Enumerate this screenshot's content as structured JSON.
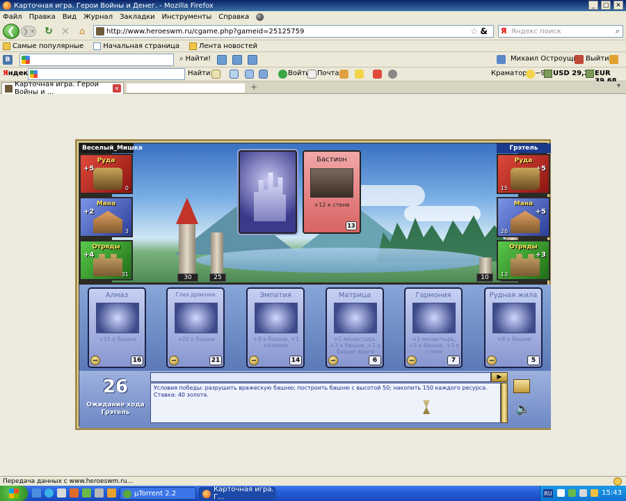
{
  "window": {
    "title": "Карточная игра. Герои Войны и Денег. - Mozilla Firefox"
  },
  "menu": [
    "Файл",
    "Правка",
    "Вид",
    "Журнал",
    "Закладки",
    "Инструменты",
    "Справка"
  ],
  "nav": {
    "url": "http://www.heroeswm.ru/cgame.php?gameid=25125759",
    "search_placeholder": "Яндекс поиск",
    "search_engine_label": "Я"
  },
  "bookmarks": [
    "Самые популярные",
    "Начальная страница",
    "Лента новостей"
  ],
  "toolbar1": {
    "find_label": "Найти!",
    "user_name": "Михаил Остроущко",
    "exit_label": "Выйти",
    "vk_label": "В"
  },
  "toolbar2": {
    "yandex_label_red": "Я",
    "yandex_label_black": "ндекс",
    "find_label": "Найти",
    "login_label": "Войти",
    "mail_label": "Почта",
    "city": "Краматорск",
    "weather": "−9",
    "usd": "USD 29,29",
    "eur": "EUR 39,68"
  },
  "tabs": [
    {
      "label": "Карточная игра. Герои Войны и ..."
    }
  ],
  "game": {
    "left_player": {
      "name": "Веселый_Мишка",
      "resources": [
        {
          "title": "Руда",
          "gain": "+5",
          "amount": "0",
          "color": "red"
        },
        {
          "title": "Мана",
          "gain": "+2",
          "amount": "3",
          "color": "blue"
        },
        {
          "title": "Отряды",
          "gain": "+4",
          "amount": "31",
          "color": "green"
        }
      ],
      "tower": "30",
      "wall": "25"
    },
    "right_player": {
      "name": "Грэтель",
      "resources": [
        {
          "title": "Руда",
          "gain": "+5",
          "amount": "15",
          "color": "red"
        },
        {
          "title": "Мана",
          "gain": "+5",
          "amount": "26",
          "color": "blue"
        },
        {
          "title": "Отряды",
          "gain": "+3",
          "amount": "13",
          "color": "green"
        }
      ],
      "tower": "27",
      "wall": "10"
    },
    "played_card": {
      "title": "Бастион",
      "description": "+12 к стене",
      "cost": "13"
    },
    "hand": [
      {
        "title": "Алмаз",
        "description": "+15 к башне",
        "cost": "16",
        "small": false
      },
      {
        "title": "Глаз дракона",
        "description": "+20 к башне",
        "cost": "21",
        "small": true
      },
      {
        "title": "Эмпатия",
        "description": "+8 к башне, +1 казарма",
        "cost": "14",
        "small": false
      },
      {
        "title": "Матрица",
        "description": "+1 монастырь, +3 к башне, +1 к башне врага",
        "cost": "6",
        "small": false
      },
      {
        "title": "Гармония",
        "description": "+1 монастырь, +3 к башне, +3 к стене",
        "cost": "7",
        "small": false
      },
      {
        "title": "Рудная жила",
        "description": "+8 к башне",
        "cost": "5",
        "small": false
      }
    ],
    "turn": {
      "number": "26",
      "status": "Ожидание хода Грэтель"
    },
    "log_text": "Условия победы: разрушить вражескую башню; построить башню с высотой 50; накопить 150 каждого ресурса. Ставка: 40 золота."
  },
  "status_bar": "Передача данных с www.heroeswm.ru...",
  "taskbar": {
    "tasks": [
      "µTorrent 2.2",
      "Карточная игра. Г..."
    ],
    "lang": "RU",
    "clock": "15:43"
  }
}
